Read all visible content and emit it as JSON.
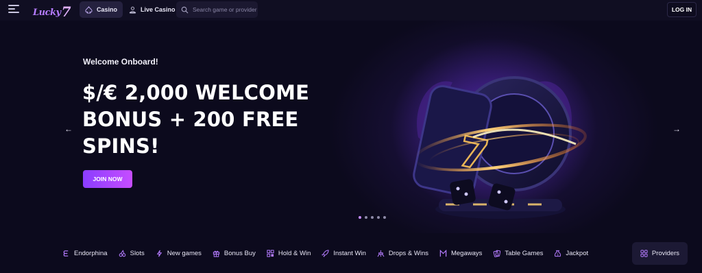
{
  "header": {
    "logo_text": "Lucky",
    "logo_mark": "7",
    "tabs": [
      {
        "label": "Casino",
        "icon": "spade-icon",
        "active": true
      },
      {
        "label": "Live Casino",
        "icon": "dealer-icon",
        "active": false
      }
    ],
    "search": {
      "placeholder": "Search game or provider",
      "value": ""
    },
    "login_label": "LOG IN"
  },
  "hero": {
    "welcome": "Welcome Onboard!",
    "headline": "$/€ 2,000 WELCOME BONUS + 200 FREE SPINS!",
    "cta_label": "JOIN NOW",
    "prev_icon": "arrow-left-icon",
    "next_icon": "arrow-right-icon",
    "slide_count": 5,
    "active_slide": 1
  },
  "categories": [
    {
      "label": "Endorphina",
      "icon": "endorphina-icon"
    },
    {
      "label": "Slots",
      "icon": "cherries-icon"
    },
    {
      "label": "New games",
      "icon": "lightning-icon"
    },
    {
      "label": "Bonus Buy",
      "icon": "gift-icon"
    },
    {
      "label": "Hold & Win",
      "icon": "grid-icon"
    },
    {
      "label": "Instant Win",
      "icon": "rocket-icon"
    },
    {
      "label": "Drops & Wins",
      "icon": "drops-icon"
    },
    {
      "label": "Megaways",
      "icon": "megaways-icon"
    },
    {
      "label": "Table Games",
      "icon": "cards-icon"
    },
    {
      "label": "Jackpot",
      "icon": "moneybag-icon"
    }
  ],
  "providers_label": "Providers",
  "colors": {
    "background": "#0c0a1d",
    "accent": "#b57cff",
    "cta_start": "#8a3dff",
    "cta_end": "#c64dff"
  }
}
